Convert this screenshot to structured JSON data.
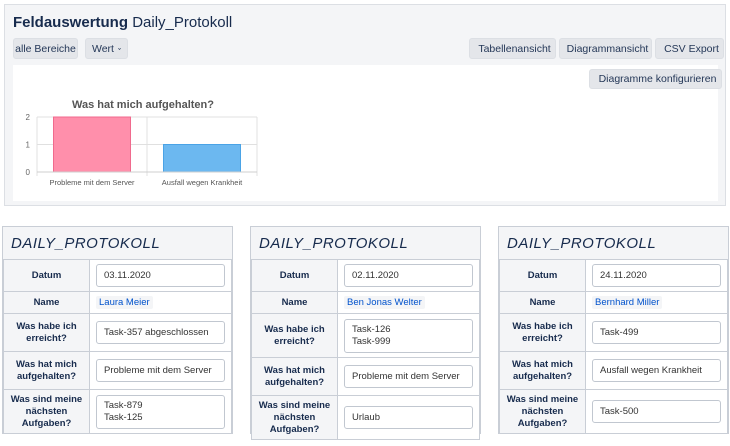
{
  "header": {
    "title_bold": "Feldauswertung",
    "title_rest": "Daily_Protokoll"
  },
  "toolbar": {
    "scope_label": "alle Bereiche",
    "value_label": "Wert",
    "table_view_label": "Tabellenansicht",
    "chart_view_label": "Diagrammansicht",
    "csv_export_label": "CSV Export",
    "configure_label": "Diagramme konfigurieren"
  },
  "chart_data": {
    "type": "bar",
    "title": "Was hat mich aufgehalten?",
    "categories": [
      "Probleme mit dem Server",
      "Ausfall wegen Krankheit"
    ],
    "values": [
      2,
      1
    ],
    "colors": [
      "#ff8fab",
      "#6cb8f0"
    ],
    "ylim": [
      0,
      2
    ],
    "yticks": [
      "0",
      "1",
      "2"
    ],
    "grid": true
  },
  "cards": [
    {
      "title": "DAILY_PROTOKOLL",
      "date_label": "Datum",
      "date": "03.11.2020",
      "name_label": "Name",
      "name": "Laura Meier",
      "achieved_label": "Was habe ich erreicht?",
      "achieved": [
        "Task-357 abgeschlossen"
      ],
      "blocked_label": "Was hat mich aufgehalten?",
      "blocked": "Probleme mit dem Server",
      "next_label": "Was sind meine nächsten Aufgaben?",
      "next": [
        "Task-879",
        "Task-125"
      ]
    },
    {
      "title": "DAILY_PROTOKOLL",
      "date_label": "Datum",
      "date": "02.11.2020",
      "name_label": "Name",
      "name": "Ben Jonas Welter",
      "achieved_label": "Was habe ich erreicht?",
      "achieved": [
        "Task-126",
        "Task-999"
      ],
      "blocked_label": "Was hat mich aufgehalten?",
      "blocked": "Probleme mit dem Server",
      "next_label": "Was sind meine nächsten Aufgaben?",
      "next": [
        "Urlaub"
      ]
    },
    {
      "title": "DAILY_PROTOKOLL",
      "date_label": "Datum",
      "date": "24.11.2020",
      "name_label": "Name",
      "name": "Bernhard Miller",
      "achieved_label": "Was habe ich erreicht?",
      "achieved": [
        "Task-499"
      ],
      "blocked_label": "Was hat mich aufgehalten?",
      "blocked": "Ausfall wegen Krankheit",
      "next_label": "Was sind meine nächsten Aufgaben?",
      "next": [
        "Task-500"
      ]
    }
  ]
}
